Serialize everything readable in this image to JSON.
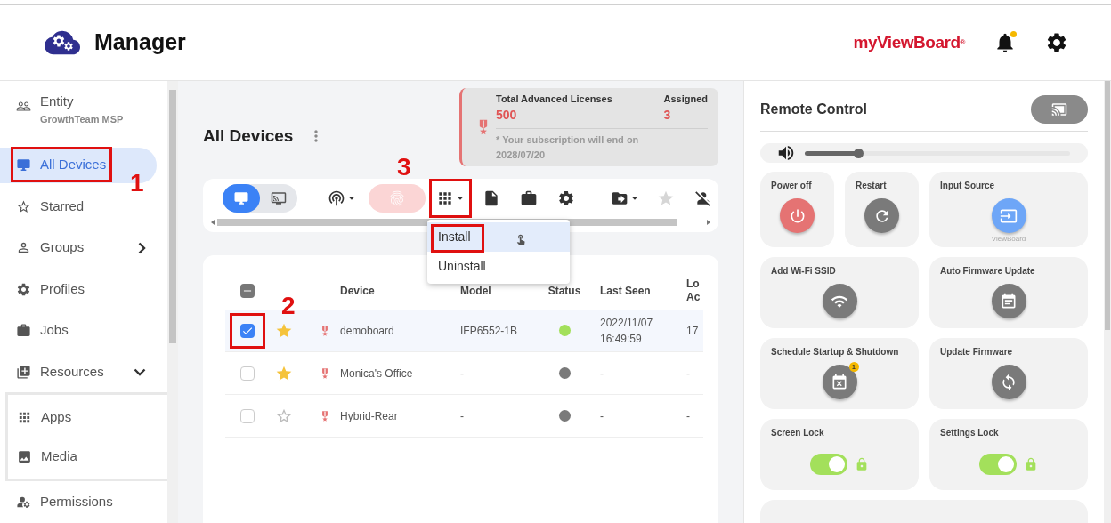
{
  "header": {
    "app_title": "Manager",
    "brand": "myViewBoard",
    "brand_mark": "®",
    "notification_dot": true
  },
  "sidebar": {
    "entity": {
      "label": "Entity",
      "name": "GrowthTeam MSP"
    },
    "items": [
      {
        "label": "All Devices",
        "selected": true,
        "highlighted": true,
        "step": "1"
      },
      {
        "label": "Starred",
        "selected": false
      },
      {
        "label": "Groups",
        "selected": false,
        "expanded": false
      },
      {
        "label": "Profiles",
        "selected": false
      },
      {
        "label": "Jobs",
        "selected": false
      },
      {
        "label": "Resources",
        "selected": false,
        "expanded": true,
        "children": [
          {
            "label": "Apps",
            "selected": false
          },
          {
            "label": "Media",
            "selected": false
          }
        ]
      },
      {
        "label": "Permissions",
        "selected": false
      }
    ]
  },
  "main": {
    "title": "All Devices",
    "license": {
      "title": "Total Advanced Licenses",
      "total": "500",
      "assigned_label": "Assigned",
      "assigned": "3",
      "note": "* Your subscription will end on 2028/07/20"
    },
    "view_toggle": [
      {
        "selected": true
      },
      {
        "selected": false
      }
    ],
    "actions": [
      {
        "dropdown": true,
        "disabled": false
      },
      {
        "dropdown": false,
        "disabled": true
      },
      {
        "dropdown": true,
        "disabled": false,
        "highlighted": true,
        "step": "3"
      },
      {
        "dropdown": false,
        "disabled": false
      },
      {
        "dropdown": false,
        "disabled": false
      },
      {
        "dropdown": false,
        "disabled": false
      },
      {
        "dropdown": true,
        "disabled": false
      },
      {
        "dropdown": false,
        "disabled": true
      },
      {
        "dropdown": false,
        "disabled": false
      }
    ],
    "menu": [
      {
        "label": "Install",
        "selected": true,
        "highlighted": true
      },
      {
        "label": "Uninstall",
        "selected": false
      }
    ],
    "table": {
      "select_all_partial": true,
      "columns": [
        "Device",
        "Model",
        "Status",
        "Last Seen",
        "Lo Ac"
      ],
      "rows": [
        {
          "checked": true,
          "highlighted": true,
          "step": "2",
          "starred": true,
          "device": "demoboard",
          "model": "IFP6552-1B",
          "color": "#a3e05b",
          "last_seen": "2022/11/07 16:49:59",
          "column_5": "17"
        },
        {
          "checked": false,
          "starred": true,
          "device": "Monica's Office",
          "model": "-",
          "color": "#7a7a7a",
          "last_seen": "-",
          "column_5": "-"
        },
        {
          "checked": false,
          "starred": false,
          "device": "Hybrid-Rear",
          "model": "-",
          "color": "#7a7a7a",
          "last_seen": "-",
          "column_5": "-"
        }
      ]
    }
  },
  "remote": {
    "title": "Remote Control",
    "volume": {
      "level": 0.2
    },
    "tiles": [
      {
        "kind": "button",
        "label": "Power off",
        "color": "#e57373"
      },
      {
        "kind": "button",
        "label": "Restart",
        "color": "#7a7a7a"
      },
      {
        "kind": "button",
        "label": "Input Source",
        "color": "#6ea6f7",
        "caption": "ViewBoard"
      },
      {
        "kind": "button",
        "label": "Add Wi-Fi SSID",
        "color": "#7a7a7a"
      },
      {
        "kind": "button",
        "label": "Auto Firmware Update",
        "color": "#7a7a7a"
      },
      {
        "kind": "button",
        "label": "Schedule Startup & Shutdown",
        "color": "#7a7a7a",
        "badge": "1"
      },
      {
        "kind": "button",
        "label": "Update Firmware",
        "color": "#7a7a7a"
      },
      {
        "kind": "toggle",
        "label": "Screen Lock",
        "on": true
      },
      {
        "kind": "toggle",
        "label": "Settings Lock",
        "on": true
      }
    ]
  }
}
